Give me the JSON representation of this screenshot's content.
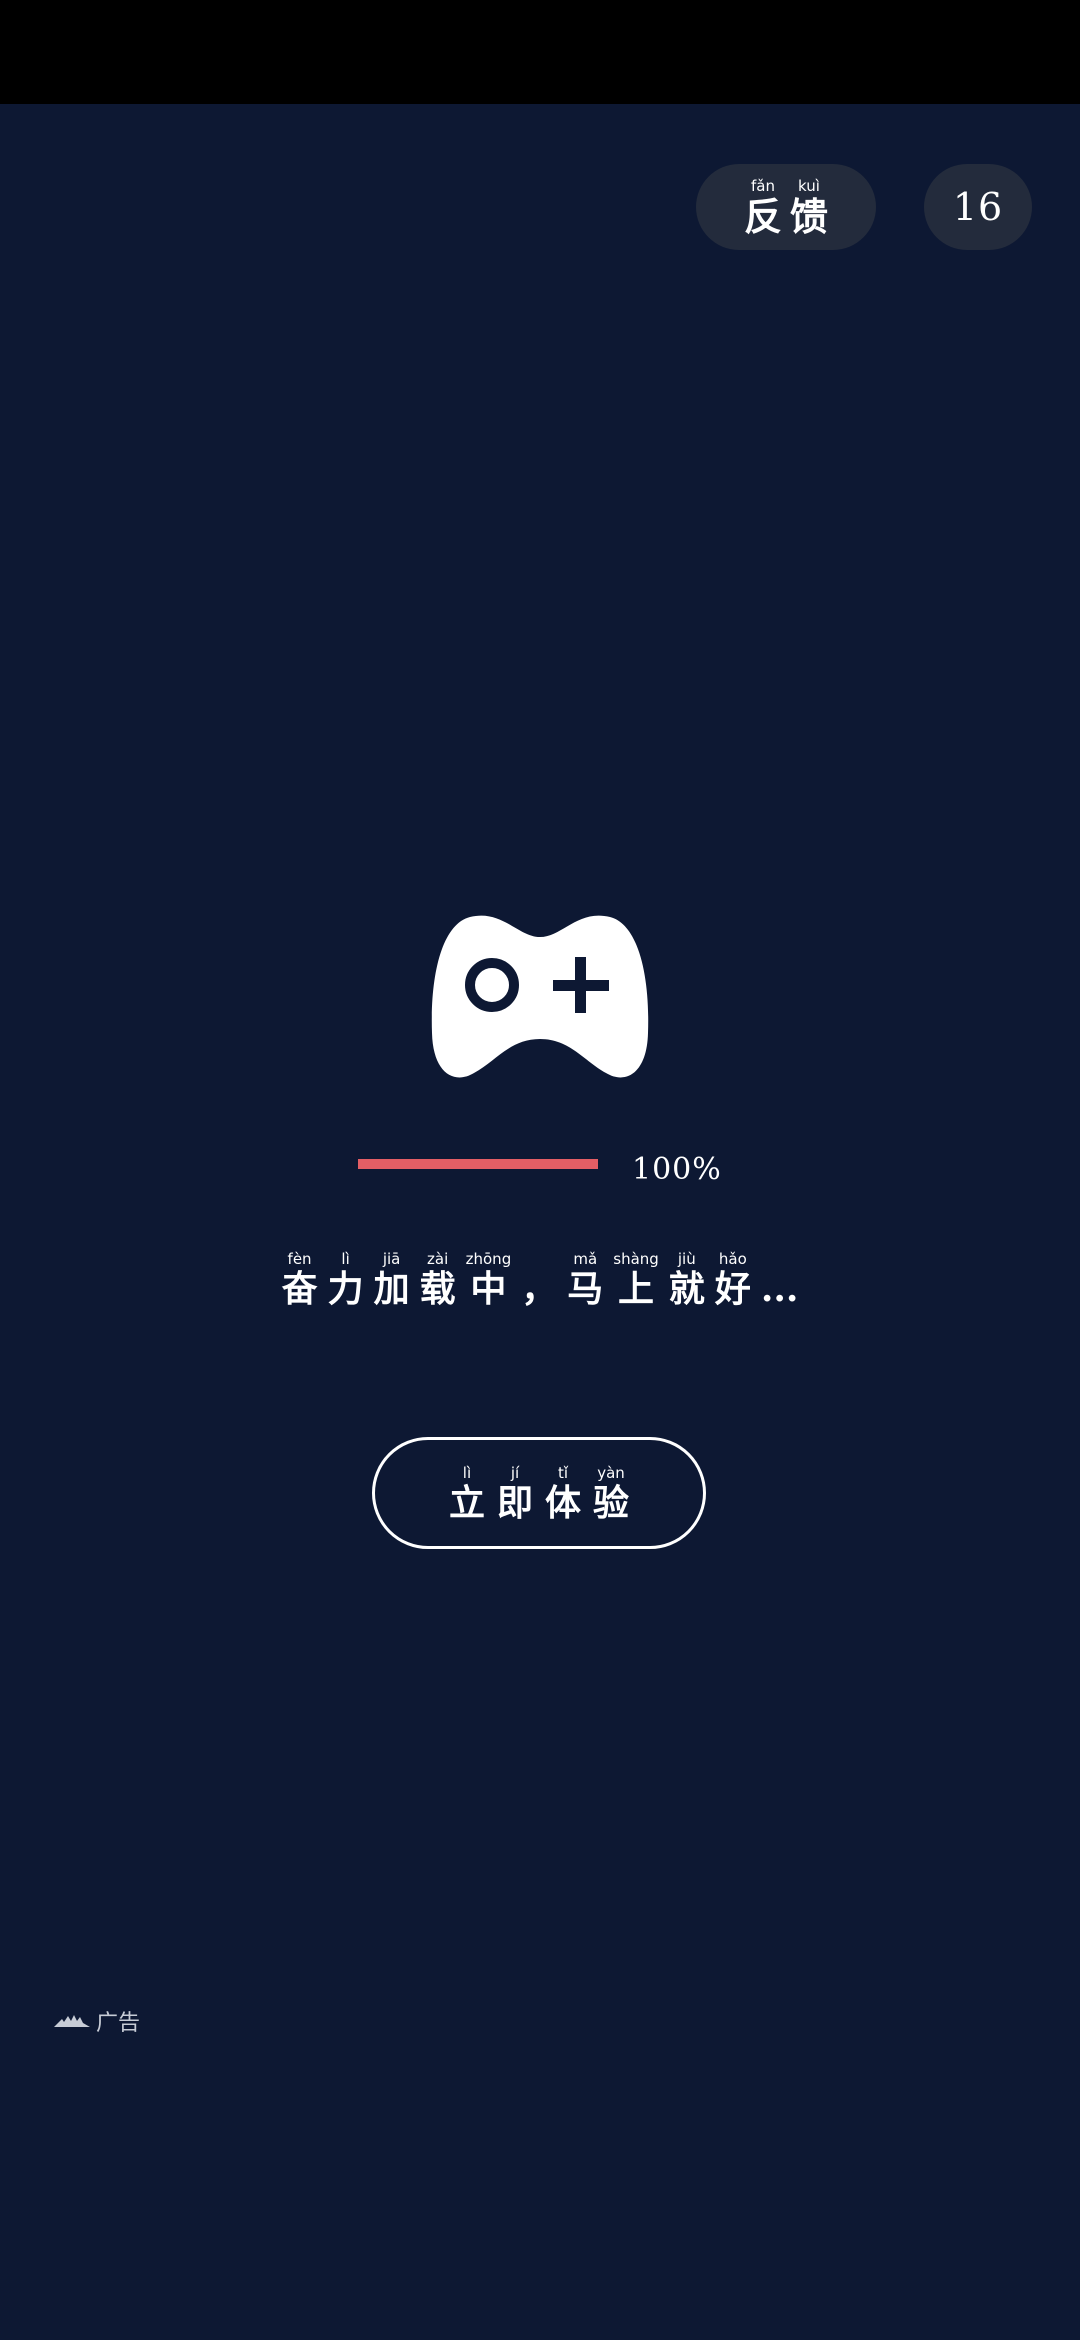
{
  "header": {
    "feedback": {
      "chars": [
        {
          "pinyin": "fǎn",
          "hanzi": "反"
        },
        {
          "pinyin": "kuì",
          "hanzi": "馈"
        }
      ]
    },
    "countdown": "16"
  },
  "icons": {
    "main": "game-controller-icon",
    "ad": "ad-logo-icon"
  },
  "progress": {
    "value": 100,
    "label": "100%"
  },
  "loading": {
    "chars": [
      {
        "pinyin": "fèn",
        "hanzi": "奋"
      },
      {
        "pinyin": "lì",
        "hanzi": "力"
      },
      {
        "pinyin": "jiā",
        "hanzi": "加"
      },
      {
        "pinyin": "zài",
        "hanzi": "载"
      },
      {
        "pinyin": "zhōng",
        "hanzi": "中"
      },
      {
        "pinyin": "",
        "hanzi": "，"
      },
      {
        "pinyin": "mǎ",
        "hanzi": "马"
      },
      {
        "pinyin": "shàng",
        "hanzi": "上"
      },
      {
        "pinyin": "jiù",
        "hanzi": "就"
      },
      {
        "pinyin": "hǎo",
        "hanzi": "好"
      },
      {
        "pinyin": "",
        "hanzi": "..."
      }
    ]
  },
  "start_button": {
    "chars": [
      {
        "pinyin": "lì",
        "hanzi": "立"
      },
      {
        "pinyin": "jí",
        "hanzi": "即"
      },
      {
        "pinyin": "tǐ",
        "hanzi": "体"
      },
      {
        "pinyin": "yàn",
        "hanzi": "验"
      }
    ]
  },
  "ad": {
    "label": "广告"
  },
  "colors": {
    "background": "#0d1833",
    "progress_fill": "#e35e65",
    "pill_bg": "#232b3c"
  }
}
